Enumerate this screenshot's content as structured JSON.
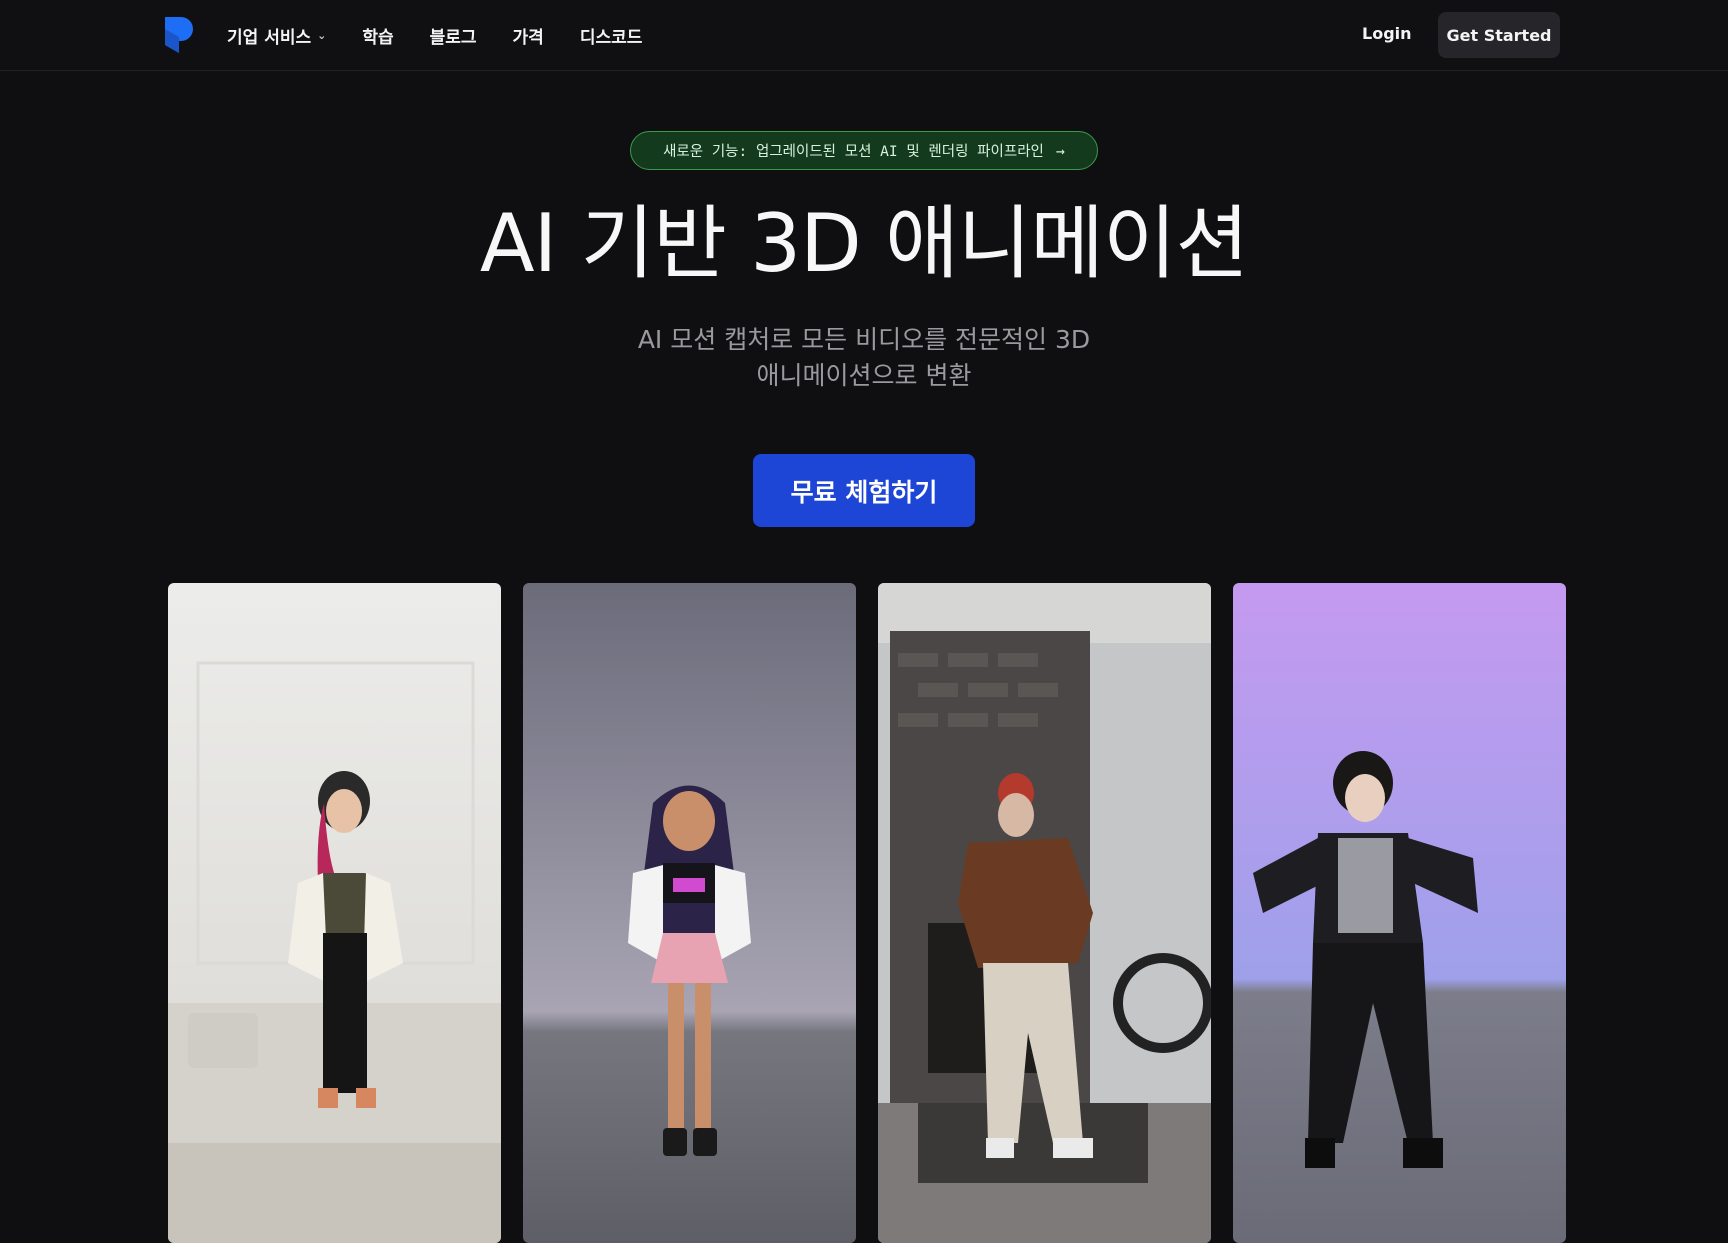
{
  "brand": {
    "name": "logo",
    "color": "#1d6ef5"
  },
  "nav": {
    "items": [
      {
        "label": "기업 서비스",
        "has_dropdown": true
      },
      {
        "label": "학습"
      },
      {
        "label": "블로그"
      },
      {
        "label": "가격"
      },
      {
        "label": "디스코드"
      }
    ],
    "login_label": "Login",
    "get_started_label": "Get Started"
  },
  "hero": {
    "announcement": "새로운 기능: 업그레이드된 모션 AI 및 렌더링 파이프라인",
    "announcement_icon": "arrow-right-icon",
    "title": "AI 기반 3D 애니메이션",
    "subtitle_line1": "AI 모션 캡처로 모든 비디오를 전문적인 3D",
    "subtitle_line2": "애니메이션으로 변환",
    "cta_label": "무료 체험하기"
  },
  "gallery": {
    "cards": [
      {
        "name": "video-woman-dancing"
      },
      {
        "name": "anime-avatar-girl"
      },
      {
        "name": "video-man-dancing"
      },
      {
        "name": "anime-avatar-boy"
      }
    ]
  },
  "colors": {
    "background": "#0f0f11",
    "accent": "#1d45d6",
    "announcement_border": "#3a9a4a",
    "announcement_bg": "#143a1e"
  }
}
